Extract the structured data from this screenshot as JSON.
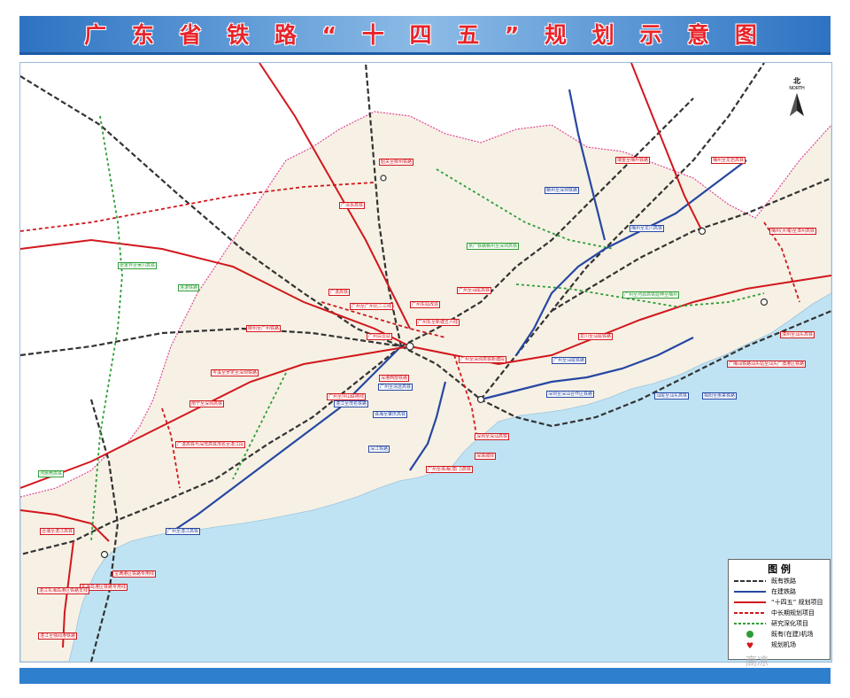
{
  "title": "广 东 省 铁 路 “ 十 四 五 ” 规 划 示 意 图",
  "compass": {
    "cn": "北",
    "en": "NORTH"
  },
  "legend": {
    "title": "图 例",
    "items": [
      {
        "label": "既有铁路",
        "style": "existing",
        "color": "#333333"
      },
      {
        "label": "在建铁路",
        "style": "construction",
        "color": "#2747a3"
      },
      {
        "label": "“十四五” 规划项目",
        "style": "plan",
        "color": "#d2171d"
      },
      {
        "label": "中长期规划项目",
        "style": "longterm",
        "color": "#d2171d"
      },
      {
        "label": "研究深化项目",
        "style": "research",
        "color": "#2f9d36"
      },
      {
        "label": "既有(在建)机场",
        "style": "airport",
        "color": "#2f9d36"
      },
      {
        "label": "规划机场",
        "style": "planned-airport",
        "color": "#d2171d"
      }
    ]
  },
  "watermark": "高凉",
  "colors": {
    "sea": "#bfe3f3",
    "land": "#f6f1e4",
    "border": "#e0479a",
    "existing": "#333333",
    "construction": "#2747a3",
    "plan": "#d2171d",
    "research": "#2f9d36"
  },
  "labels": [
    {
      "text": "韶关至柳州铁路",
      "kind": "red"
    },
    {
      "text": "广清永高铁",
      "kind": "red"
    },
    {
      "text": "广州至汕尾高铁",
      "kind": "red"
    },
    {
      "text": "广州东站改造",
      "kind": "red"
    },
    {
      "text": "广州东至新塘五六线",
      "kind": "red"
    },
    {
      "text": "广州白云站",
      "kind": "red"
    },
    {
      "text": "广湛高铁",
      "kind": "red"
    },
    {
      "text": "广州至广州北二三线",
      "kind": "red"
    },
    {
      "text": "柳州至广州铁路",
      "kind": "red"
    },
    {
      "text": "岑溪至罗定至深圳铁路",
      "kind": "red"
    },
    {
      "text": "南宁至深圳高铁",
      "kind": "red"
    },
    {
      "text": "广州至珠海(澳门)高铁",
      "kind": "red"
    },
    {
      "text": "广州至深圳高铁新塘段",
      "kind": "red"
    },
    {
      "text": "广州至坪山联络线",
      "kind": "red"
    },
    {
      "text": "深圳至深汕高铁",
      "kind": "red"
    },
    {
      "text": "深珠城际",
      "kind": "red"
    },
    {
      "text": "深港西部铁路",
      "kind": "red"
    },
    {
      "text": "梅州至龙岩高铁",
      "kind": "red"
    },
    {
      "text": "瑞金至梅州铁路",
      "kind": "red"
    },
    {
      "text": "梅州(大埔)至漳州高铁",
      "kind": "red"
    },
    {
      "text": "龙川至汕尾铁路",
      "kind": "red"
    },
    {
      "text": "广梅汕铁路汕头站至汕头广澳港区铁路",
      "kind": "red"
    },
    {
      "text": "漳州至汕头高铁",
      "kind": "red"
    },
    {
      "text": "广湛高铁与深茂高铁茂名至湛江段",
      "kind": "red"
    },
    {
      "text": "合浦至湛江高铁",
      "kind": "red"
    },
    {
      "text": "东海岛港区铁路专用线",
      "kind": "red"
    },
    {
      "text": "宝满港区铁路专用线",
      "kind": "red"
    },
    {
      "text": "湛江至徐闻港铁路",
      "kind": "red"
    },
    {
      "text": "湛江东海岛港区铁路支线",
      "kind": "red"
    },
    {
      "text": "深江铁路",
      "kind": "blue"
    },
    {
      "text": "珠海至肇庆高铁",
      "kind": "blue"
    },
    {
      "text": "广州至汕尾铁路",
      "kind": "blue"
    },
    {
      "text": "广州至清远高铁",
      "kind": "blue"
    },
    {
      "text": "广州至湛江高铁",
      "kind": "blue"
    },
    {
      "text": "汕尾至汕头高铁",
      "kind": "blue"
    },
    {
      "text": "揭阳至惠来铁路",
      "kind": "blue"
    },
    {
      "text": "深圳至深汕合作区铁路",
      "kind": "blue"
    },
    {
      "text": "赣州至深圳铁路",
      "kind": "blue"
    },
    {
      "text": "梅州至龙川高铁",
      "kind": "blue"
    },
    {
      "text": "湛江至茂名铁路",
      "kind": "blue"
    },
    {
      "text": "张家界至吴川高铁",
      "kind": "green"
    },
    {
      "text": "洛湛铁路",
      "kind": "green"
    },
    {
      "text": "河惠莞高铁",
      "kind": "green"
    },
    {
      "text": "广州至河源高铁延伸至梅州",
      "kind": "green"
    },
    {
      "text": "京广铁路赣州至深圳高铁",
      "kind": "green"
    }
  ]
}
